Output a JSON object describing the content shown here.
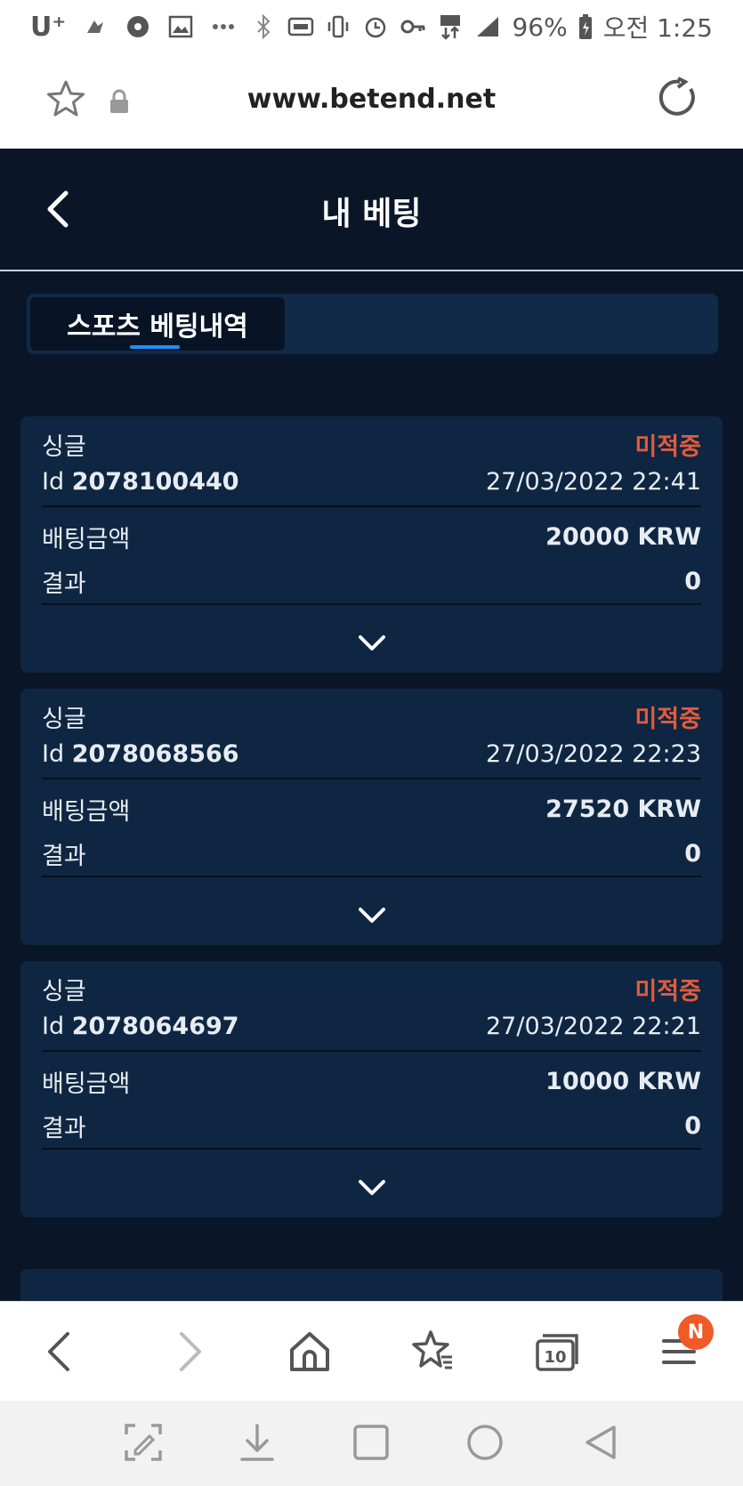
{
  "statusbar": {
    "carrier": "U⁺",
    "battery": "96%",
    "time": "오전 1:25",
    "icons": [
      "maps-icon",
      "gear-icon",
      "gallery-icon",
      "more-icon",
      "bluetooth-icon",
      "nfc-icon",
      "vibrate-icon",
      "alarm-icon",
      "key-icon",
      "lte-icon",
      "signal-icon",
      "battery-icon"
    ]
  },
  "browser": {
    "url": "www.betend.net"
  },
  "header": {
    "title": "내 베팅"
  },
  "tabs": [
    {
      "label": "스포츠 베팅내역",
      "active": true
    }
  ],
  "bets": [
    {
      "type": "싱글",
      "status": "미적중",
      "id_label": "Id",
      "id": "2078100440",
      "datetime": "27/03/2022 22:41",
      "amount_label": "배팅금액",
      "amount": "20000 KRW",
      "result_label": "결과",
      "result": "0"
    },
    {
      "type": "싱글",
      "status": "미적중",
      "id_label": "Id",
      "id": "2078068566",
      "datetime": "27/03/2022 22:23",
      "amount_label": "배팅금액",
      "amount": "27520 KRW",
      "result_label": "결과",
      "result": "0"
    },
    {
      "type": "싱글",
      "status": "미적중",
      "id_label": "Id",
      "id": "2078064697",
      "datetime": "27/03/2022 22:21",
      "amount_label": "배팅금액",
      "amount": "10000 KRW",
      "result_label": "결과",
      "result": "0"
    }
  ],
  "toolbar": {
    "tabs_count": "10",
    "menu_badge": "N"
  },
  "colors": {
    "page_bg": "#0a1628",
    "card_bg": "#0e2641",
    "status_red": "#e25b3c",
    "tab_indicator": "#1e90ff",
    "badge": "#f05a28"
  }
}
